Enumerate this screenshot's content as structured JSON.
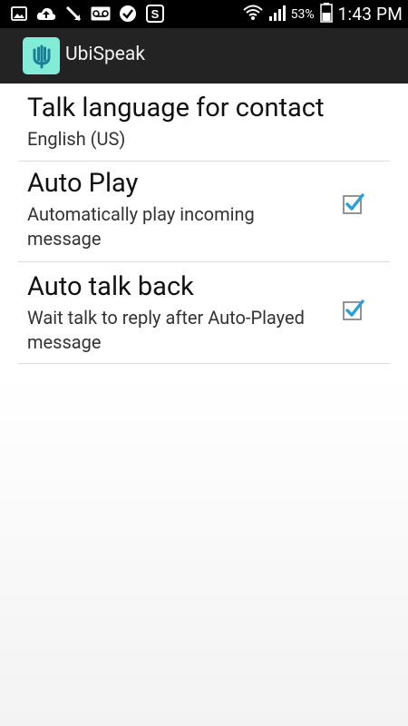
{
  "status_bar": {
    "icons_left": [
      "gallery-icon",
      "cloud-upload-icon",
      "missed-call-icon",
      "voicemail-icon",
      "check-icon",
      "s-app-icon"
    ],
    "icons_right": [
      "wifi-icon",
      "signal-icon",
      "battery-icon"
    ],
    "battery_percent": "53%",
    "time": "1:43 PM"
  },
  "app_bar": {
    "title": "UbiSpeak",
    "logo_icon": "waveform-icon"
  },
  "preferences": [
    {
      "title": "Talk language for contact",
      "summary": "English (US)"
    },
    {
      "title": "Auto Play",
      "summary": "Automatically play incoming message",
      "checked": true
    },
    {
      "title": "Auto talk back",
      "summary": "Wait talk to reply after Auto-Played message",
      "checked": true
    }
  ],
  "colors": {
    "status_bar": "#000000",
    "app_bar": "#232323",
    "logo_bg": "#82ecd7",
    "logo_fg": "#1d7f95",
    "checkbox_check": "#2a9fd8"
  }
}
